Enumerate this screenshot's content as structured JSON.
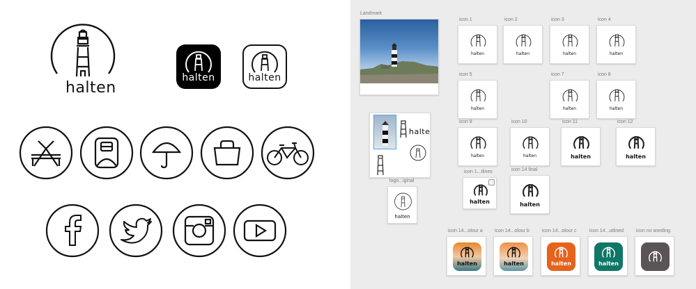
{
  "brand": {
    "wordmark": "halten",
    "colors": {
      "ink": "#111111",
      "canvas": "#ececec",
      "orange": "#e5631c",
      "teal": "#0f7767",
      "dark": "#5a5457"
    }
  },
  "left_panel": {
    "logo_main_word": "halten",
    "app_icon_black_word": "halten",
    "app_icon_outline_word": "halten",
    "amenity_icons": [
      "picnic-table-icon",
      "backpack-icon",
      "umbrella-icon",
      "bag-icon",
      "bicycle-icon"
    ],
    "social_icons": [
      "facebook-icon",
      "twitter-icon",
      "instagram-icon",
      "youtube-icon"
    ]
  },
  "artboards": {
    "landmark": {
      "label": "Landmark"
    },
    "logo_original": {
      "label": "logo...iginal",
      "word": "halten"
    },
    "collage": {
      "word": "halten"
    },
    "grid": [
      {
        "label": "icon 1",
        "word": "halten"
      },
      {
        "label": "icon 2",
        "word": "halten"
      },
      {
        "label": "icon 3",
        "word": "halten"
      },
      {
        "label": "icon 4",
        "word": "halten"
      },
      {
        "label": "icon 5",
        "word": "halten"
      },
      {
        "label": "icon 7",
        "word": "halten"
      },
      {
        "label": "icon 8",
        "word": "halten"
      },
      {
        "label": "icon 9",
        "word": "halten"
      },
      {
        "label": "icon 10",
        "word": "halten"
      },
      {
        "label": "icon 11",
        "word": "halten"
      },
      {
        "label": "icon 12",
        "word": "halten"
      },
      {
        "label": "icon 1...tlines",
        "word": "halten"
      },
      {
        "label": "icon 14 final",
        "word": "halten"
      }
    ],
    "color_variants": [
      {
        "label": "icon 14...olour a",
        "word": "halten"
      },
      {
        "label": "icon 14...olour b",
        "word": "halten"
      },
      {
        "label": "icon 14...olour c",
        "word": "halten"
      },
      {
        "label": "icon 14...utlined",
        "word": "halten"
      },
      {
        "label": "icon no wording"
      }
    ]
  }
}
